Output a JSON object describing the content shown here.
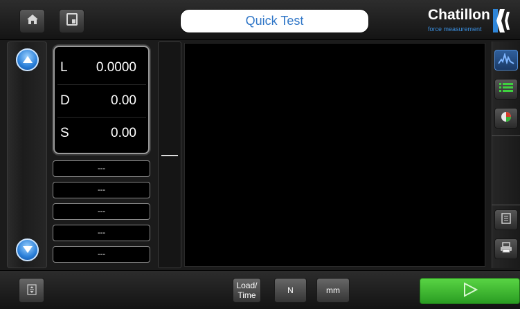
{
  "header": {
    "title": "Quick Test"
  },
  "brand": {
    "name": "Chatillon",
    "tagline": "force measurement"
  },
  "readout": [
    {
      "label": "L",
      "value": "0.0000"
    },
    {
      "label": "D",
      "value": "0.00"
    },
    {
      "label": "S",
      "value": "0.00"
    }
  ],
  "slots": [
    "---",
    "---",
    "---",
    "---",
    "---"
  ],
  "footer": {
    "load_time_label_1": "Load/",
    "load_time_label_2": "Time",
    "force_unit": "N",
    "distance_unit": "mm"
  },
  "colors": {
    "accent_blue": "#2f76c7",
    "go_green": "#39b52f",
    "graph_bg": "#000000"
  },
  "icons": [
    "home-icon",
    "save-icon",
    "scroll-up-icon",
    "scroll-down-icon",
    "graph-icon",
    "list-icon",
    "pie-chart-icon",
    "report-icon",
    "print-icon",
    "settings-icon",
    "play-icon"
  ]
}
